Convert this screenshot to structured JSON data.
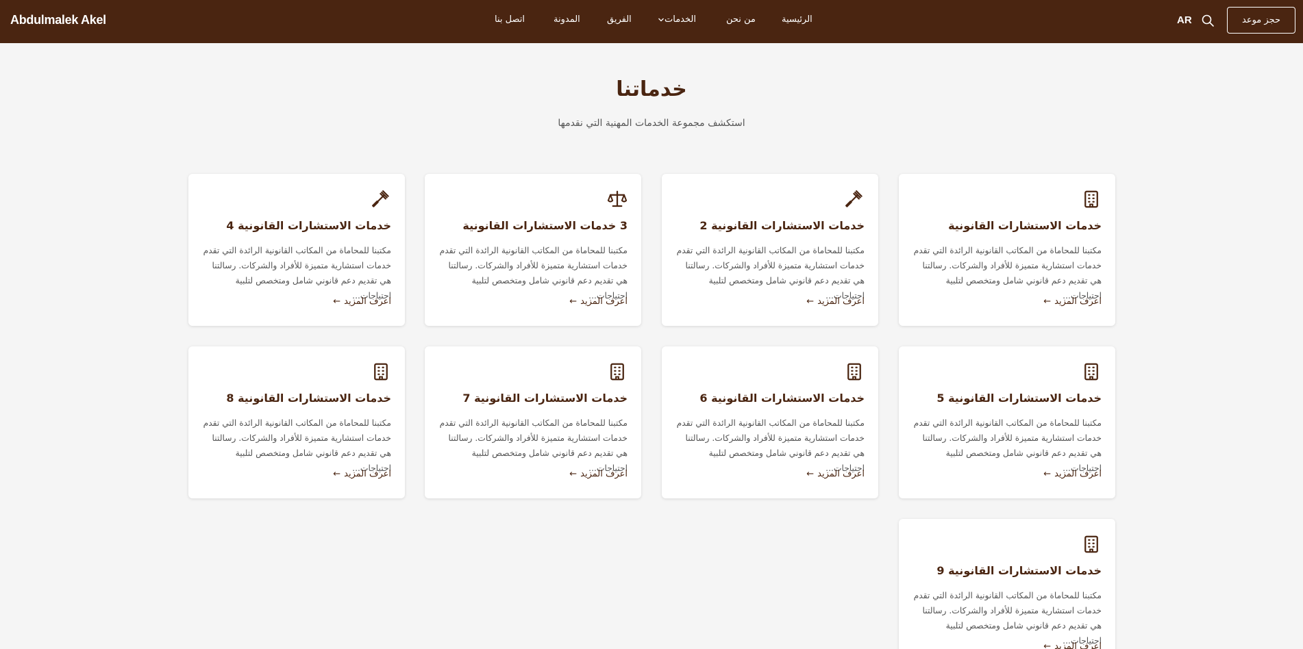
{
  "header": {
    "logo": "Abdulmalek Akel",
    "nav": [
      "الرئيسية",
      "من نحن",
      "الخدمات",
      "الفريق",
      "المدونة",
      "اتصل بنا"
    ],
    "lang": "AR",
    "book_button": "حجز موعد"
  },
  "main": {
    "title": "خدماتنا",
    "subtitle": "استكشف مجموعة الخدمات المهنية التي نقدمها"
  },
  "cards": [
    {
      "title": "خدمات الاستشارات القانونية",
      "icon": "building-icon",
      "desc": "مكتبنا للمحاماة من المكاتب القانونية الرائدة التي تقدم خدمات استشارية متميزة للأفراد والشركات. رسالتنا هي تقديم دعم قانوني شامل ومتخصص لتلبية احتياجات...",
      "link": "اعرف المزيد"
    },
    {
      "title": "خدمات الاستشارات القانونية 2",
      "icon": "gavel-icon",
      "desc": "مكتبنا للمحاماة من المكاتب القانونية الرائدة التي تقدم خدمات استشارية متميزة للأفراد والشركات. رسالتنا هي تقديم دعم قانوني شامل ومتخصص لتلبية احتياجات...",
      "link": "اعرف المزيد"
    },
    {
      "title": "3 خدمات الاستشارات القانونية",
      "icon": "scale-icon",
      "desc": "مكتبنا للمحاماة من المكاتب القانونية الرائدة التي تقدم خدمات استشارية متميزة للأفراد والشركات. رسالتنا هي تقديم دعم قانوني شامل ومتخصص لتلبية احتياجات...",
      "link": "اعرف المزيد"
    },
    {
      "title": "خدمات الاستشارات القانونية 4",
      "icon": "gavel-icon",
      "desc": "مكتبنا للمحاماة من المكاتب القانونية الرائدة التي تقدم خدمات استشارية متميزة للأفراد والشركات. رسالتنا هي تقديم دعم قانوني شامل ومتخصص لتلبية احتياجات...",
      "link": "اعرف المزيد"
    },
    {
      "title": "خدمات الاستشارات القانونية 5",
      "icon": "building-icon",
      "desc": "مكتبنا للمحاماة من المكاتب القانونية الرائدة التي تقدم خدمات استشارية متميزة للأفراد والشركات. رسالتنا هي تقديم دعم قانوني شامل ومتخصص لتلبية احتياجات...",
      "link": "اعرف المزيد"
    },
    {
      "title": "خدمات الاستشارات القانونية 6",
      "icon": "building-icon",
      "desc": "مكتبنا للمحاماة من المكاتب القانونية الرائدة التي تقدم خدمات استشارية متميزة للأفراد والشركات. رسالتنا هي تقديم دعم قانوني شامل ومتخصص لتلبية احتياجات...",
      "link": "اعرف المزيد"
    },
    {
      "title": "خدمات الاستشارات القانونية 7",
      "icon": "building-icon",
      "desc": "مكتبنا للمحاماة من المكاتب القانونية الرائدة التي تقدم خدمات استشارية متميزة للأفراد والشركات. رسالتنا هي تقديم دعم قانوني شامل ومتخصص لتلبية احتياجات...",
      "link": "اعرف المزيد"
    },
    {
      "title": "خدمات الاستشارات القانونية 8",
      "icon": "building-icon",
      "desc": "مكتبنا للمحاماة من المكاتب القانونية الرائدة التي تقدم خدمات استشارية متميزة للأفراد والشركات. رسالتنا هي تقديم دعم قانوني شامل ومتخصص لتلبية احتياجات...",
      "link": "اعرف المزيد"
    },
    {
      "title": "خدمات الاستشارات القانونية 9",
      "icon": "building-icon",
      "desc": "مكتبنا للمحاماة من المكاتب القانونية الرائدة التي تقدم خدمات استشارية متميزة للأفراد والشركات. رسالتنا هي تقديم دعم قانوني شامل ومتخصص لتلبية احتياجات...",
      "link": "اعرف المزيد"
    }
  ],
  "colors": {
    "primary": "#4a2511",
    "background": "#f5f5f5",
    "card": "#ffffff"
  }
}
